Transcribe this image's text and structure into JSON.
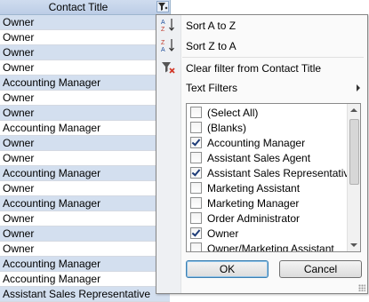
{
  "column": {
    "header": "Contact Title",
    "rows": [
      "Owner",
      "Owner",
      "Owner",
      "Owner",
      "Accounting Manager",
      "Owner",
      "Owner",
      "Accounting Manager",
      "Owner",
      "Owner",
      "Accounting Manager",
      "Owner",
      "Accounting Manager",
      "Owner",
      "Owner",
      "Owner",
      "Accounting Manager",
      "Accounting Manager",
      "Assistant Sales Representative"
    ]
  },
  "menu": {
    "sort_az": "Sort A to Z",
    "sort_za": "Sort Z to A",
    "clear_filter": "Clear filter from Contact Title",
    "text_filters": "Text Filters",
    "list": [
      {
        "label": "(Select All)",
        "checked": false
      },
      {
        "label": "(Blanks)",
        "checked": false
      },
      {
        "label": "Accounting Manager",
        "checked": true
      },
      {
        "label": "Assistant Sales Agent",
        "checked": false
      },
      {
        "label": "Assistant Sales Representative",
        "checked": true
      },
      {
        "label": "Marketing Assistant",
        "checked": false
      },
      {
        "label": "Marketing Manager",
        "checked": false
      },
      {
        "label": "Order Administrator",
        "checked": false
      },
      {
        "label": "Owner",
        "checked": true
      },
      {
        "label": "Owner/Marketing Assistant",
        "checked": false
      }
    ],
    "ok": "OK",
    "cancel": "Cancel"
  },
  "colors": {
    "alt_row": "#d3dfef",
    "header": "#bccde6",
    "accent_text": "#1e3c78"
  }
}
